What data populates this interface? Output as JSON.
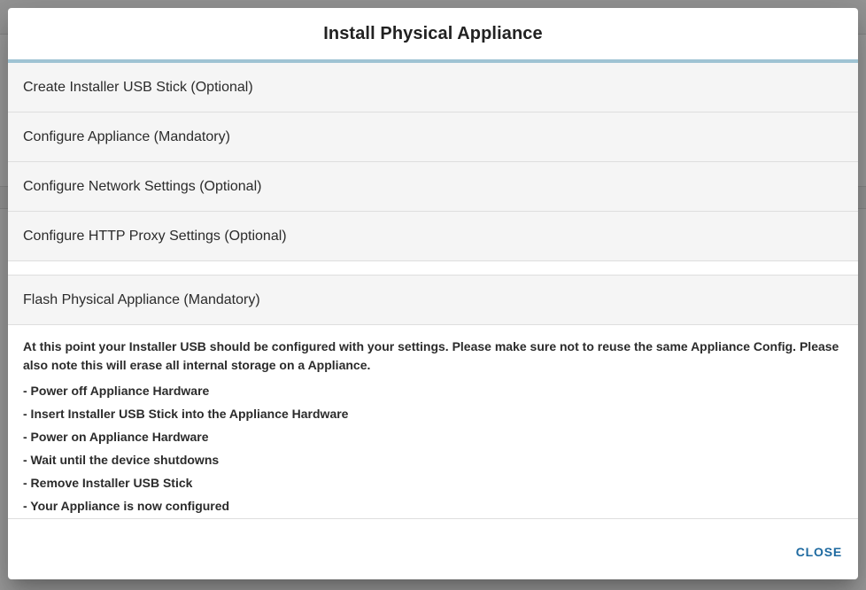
{
  "dialog": {
    "title": "Install Physical Appliance",
    "steps": [
      {
        "label": "Create Installer USB Stick (Optional)"
      },
      {
        "label": "Configure Appliance (Mandatory)"
      },
      {
        "label": "Configure Network Settings (Optional)"
      },
      {
        "label": "Configure HTTP Proxy Settings (Optional)"
      },
      {
        "label": "Flash Physical Appliance (Mandatory)"
      }
    ],
    "flash_step": {
      "intro": "At this point your Installer USB should be configured with your settings. Please make sure not to reuse the same Appliance Config. Please also note this will erase all internal storage on a Appliance.",
      "instructions": [
        "- Power off Appliance Hardware",
        "- Insert Installer USB Stick into the Appliance Hardware",
        "- Power on Appliance Hardware",
        "- Wait until the device shutdowns",
        "- Remove Installer USB Stick",
        "- Your Appliance is now configured"
      ]
    },
    "actions": {
      "close_label": "CLOSE"
    }
  },
  "colors": {
    "title_underline": "#9fc3d3",
    "step_header_bg": "#f5f5f5",
    "close_text": "#1e6aa0"
  }
}
